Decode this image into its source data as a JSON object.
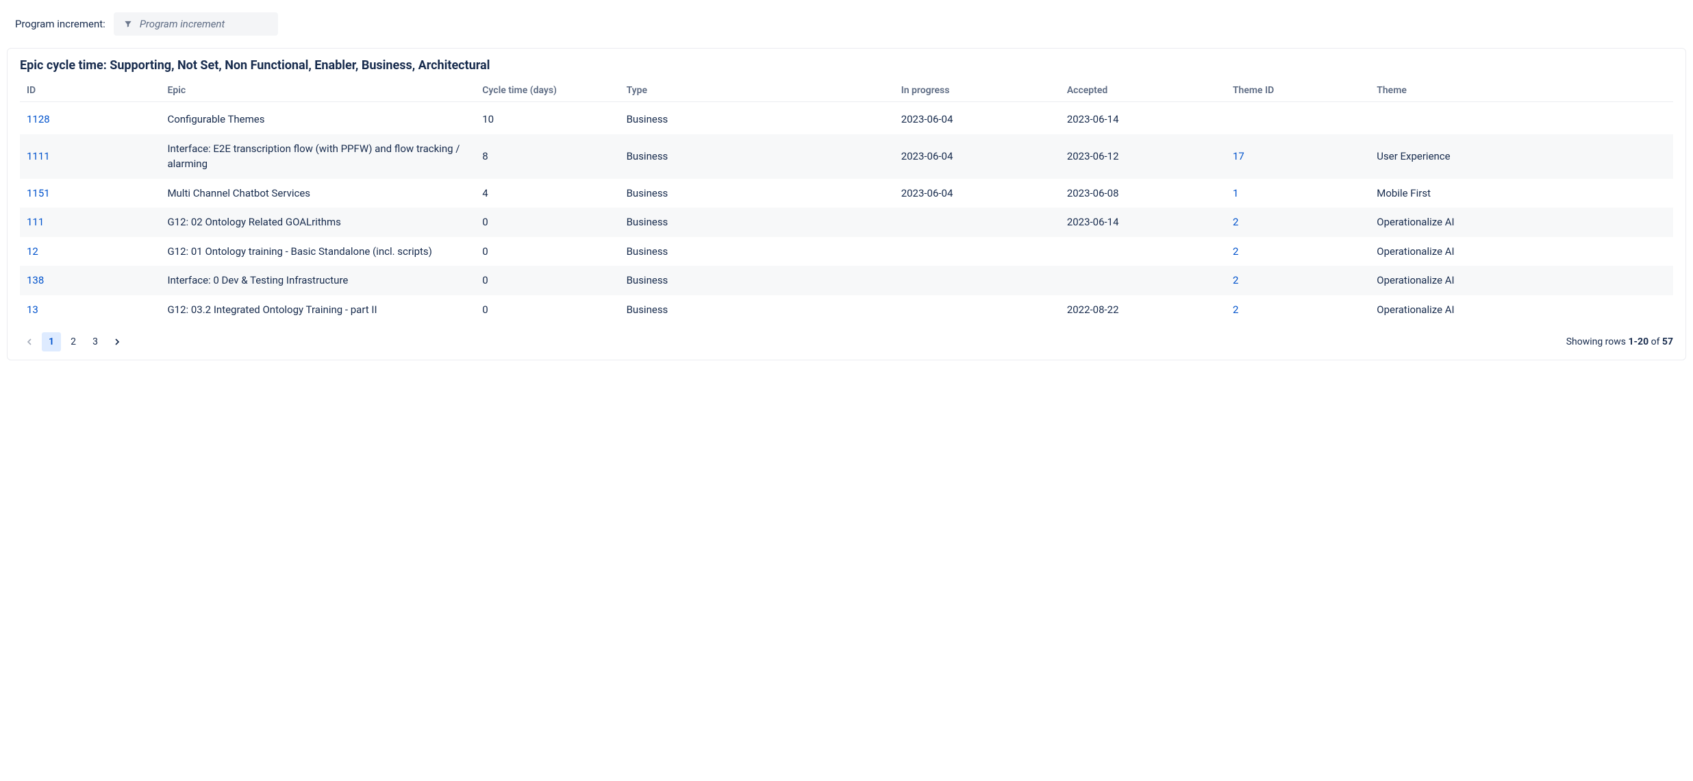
{
  "filter": {
    "label": "Program increment:",
    "placeholder": "Program increment"
  },
  "panel": {
    "title": "Epic cycle time: Supporting, Not Set, Non Functional, Enabler, Business, Architectural"
  },
  "table": {
    "headers": {
      "id": "ID",
      "epic": "Epic",
      "cycle": "Cycle time (days)",
      "type": "Type",
      "inprogress": "In progress",
      "accepted": "Accepted",
      "themeid": "Theme ID",
      "theme": "Theme"
    },
    "rows": [
      {
        "id": "1128",
        "epic": "Configurable Themes",
        "cycle": "10",
        "type": "Business",
        "inprogress": "2023-06-04",
        "accepted": "2023-06-14",
        "themeid": "",
        "theme": ""
      },
      {
        "id": "1111",
        "epic": "Interface: E2E transcription flow (with PPFW) and flow tracking / alarming",
        "cycle": "8",
        "type": "Business",
        "inprogress": "2023-06-04",
        "accepted": "2023-06-12",
        "themeid": "17",
        "theme": "User Experience"
      },
      {
        "id": "1151",
        "epic": "Multi Channel Chatbot Services",
        "cycle": "4",
        "type": "Business",
        "inprogress": "2023-06-04",
        "accepted": "2023-06-08",
        "themeid": "1",
        "theme": "Mobile First"
      },
      {
        "id": "111",
        "epic": "G12: 02 Ontology Related GOALrithms",
        "cycle": "0",
        "type": "Business",
        "inprogress": "",
        "accepted": "2023-06-14",
        "themeid": "2",
        "theme": "Operationalize AI"
      },
      {
        "id": "12",
        "epic": "G12: 01 Ontology training - Basic Standalone (incl. scripts)",
        "cycle": "0",
        "type": "Business",
        "inprogress": "",
        "accepted": "",
        "themeid": "2",
        "theme": "Operationalize AI"
      },
      {
        "id": "138",
        "epic": "Interface: 0 Dev & Testing Infrastructure",
        "cycle": "0",
        "type": "Business",
        "inprogress": "",
        "accepted": "",
        "themeid": "2",
        "theme": "Operationalize AI"
      },
      {
        "id": "13",
        "epic": "G12: 03.2 Integrated Ontology Training - part II",
        "cycle": "0",
        "type": "Business",
        "inprogress": "",
        "accepted": "2022-08-22",
        "themeid": "2",
        "theme": "Operationalize AI"
      }
    ]
  },
  "pagination": {
    "pages": [
      "1",
      "2",
      "3"
    ],
    "activePage": "1",
    "label_prefix": "Showing rows ",
    "range": "1-20",
    "label_of": " of ",
    "total": "57"
  }
}
